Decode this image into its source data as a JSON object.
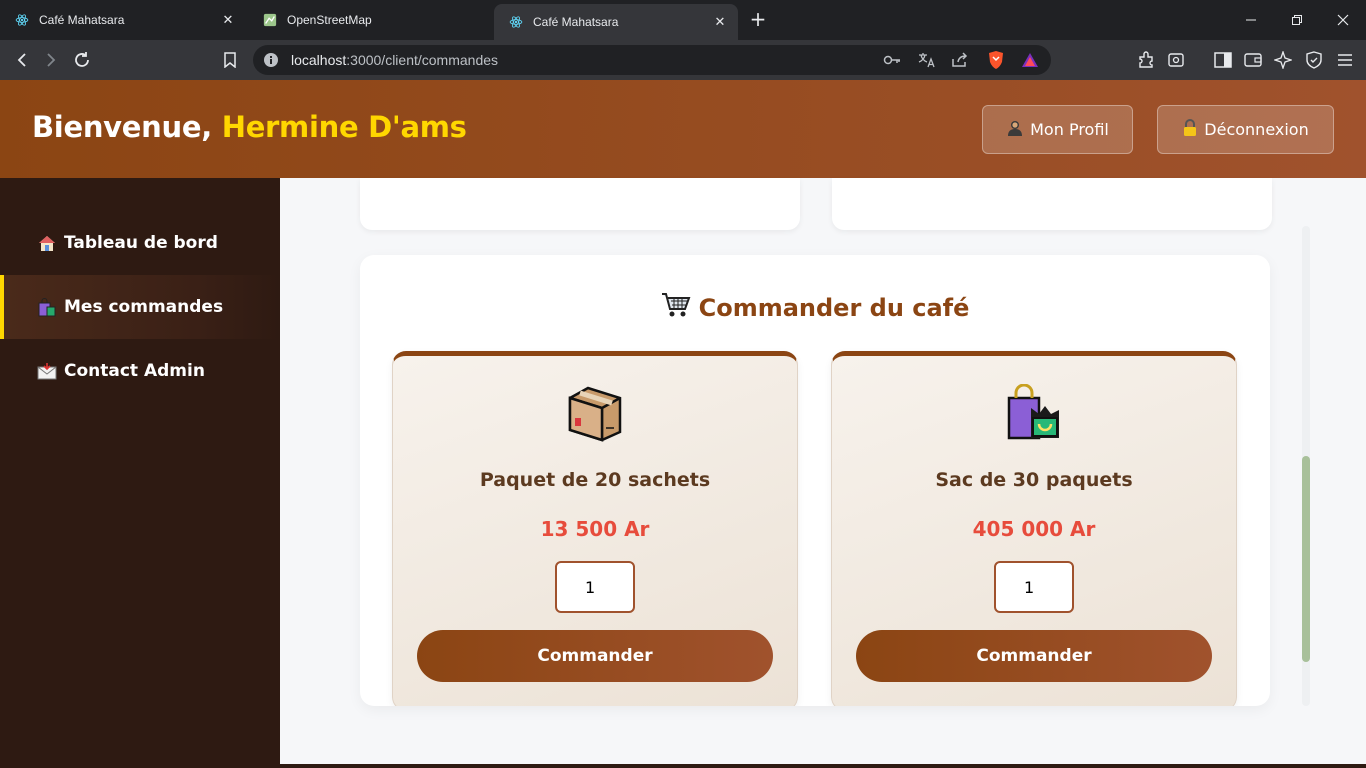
{
  "browser": {
    "tabs": [
      {
        "title": "Café Mahatsara",
        "icon": "react-icon",
        "active": false
      },
      {
        "title": "OpenStreetMap",
        "icon": "map-icon",
        "active": false
      },
      {
        "title": "Café Mahatsara",
        "icon": "react-icon",
        "active": true
      }
    ],
    "new_tab": "+",
    "url_host": "localhost",
    "url_path": ":3000/client/commandes"
  },
  "header": {
    "welcome_prefix": "Bienvenue,",
    "user_name": "Hermine D'ams",
    "profile_label": "Mon Profil",
    "logout_label": "Déconnexion"
  },
  "sidebar": {
    "items": [
      {
        "label": "Tableau de bord",
        "icon": "house-icon",
        "active": false
      },
      {
        "label": "Mes commandes",
        "icon": "shopping-bags-icon",
        "active": true
      },
      {
        "label": "Contact Admin",
        "icon": "envelope-icon",
        "active": false
      }
    ]
  },
  "order_section": {
    "title": "Commander du café",
    "products": [
      {
        "name": "Paquet de 20 sachets",
        "price": "13 500 Ar",
        "quantity": "1",
        "button": "Commander",
        "icon": "package-icon"
      },
      {
        "name": "Sac de 30 paquets",
        "price": "405 000 Ar",
        "quantity": "1",
        "button": "Commander",
        "icon": "shopping-bags-icon"
      }
    ]
  },
  "colors": {
    "brand": "#8b4513",
    "accent": "#ffd700",
    "price": "#e74c3c",
    "sidebar": "#2e1a12"
  }
}
